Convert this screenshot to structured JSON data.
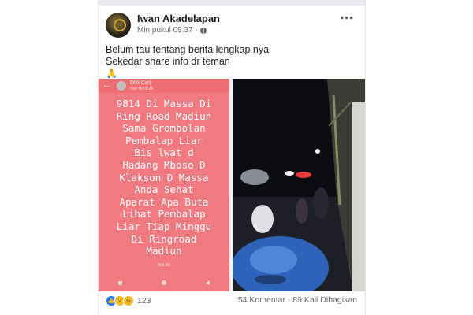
{
  "post": {
    "author": "Iwan Akadelapan",
    "timestamp": "Min pukul 09:37",
    "separator": "·",
    "text_line1": "Belum tau tentang berita lengkap nya",
    "text_line2": "Sekedar share info dr teman",
    "emoji": "🙏"
  },
  "story": {
    "author": "Diki Cvrl",
    "time": "Hari ini 09.26",
    "text": "9814 Di Massa Di\nRing Road Madiun\nSama Grombolan\nPembalap Liar\nBis lwat d\nHadang Mboso D\nKlakson D Massa\nAnda Sehat\nAparat Apa Buta\nLihat Pembalap\nLiar Tiap Minggu\nDi Ringroad\nMadiun",
    "reply": "BALAS"
  },
  "footer": {
    "reaction_count": "123",
    "stats": "54 Komentar · 89 Kali Dibagikan"
  },
  "icons": [
    "more-icon",
    "globe-icon",
    "back-arrow-icon",
    "like-icon",
    "wow-icon",
    "haha-icon"
  ],
  "colors": {
    "story_bg": "#f07a80",
    "like": "#1877f2",
    "reaction_yellow": "#f7b928"
  }
}
